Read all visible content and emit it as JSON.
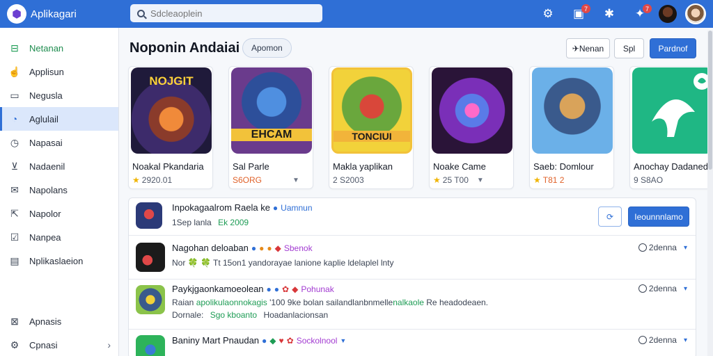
{
  "app": {
    "name": "Aplikagari"
  },
  "search": {
    "placeholder": "Sdcleaoplein"
  },
  "top_icons": [
    {
      "icon": "gear-icon"
    },
    {
      "icon": "bookmark-icon",
      "badge": "7"
    },
    {
      "icon": "bell-icon",
      "badge": ""
    },
    {
      "icon": "share-icon",
      "badge": "7"
    }
  ],
  "sidebar": {
    "items": [
      {
        "label": "Netanan",
        "icon": "store-icon"
      },
      {
        "label": "Applisun",
        "icon": "pointer-icon"
      },
      {
        "label": "Negusla",
        "icon": "window-icon"
      },
      {
        "label": "Aglulail",
        "icon": "gauge-icon",
        "active": true
      },
      {
        "label": "Napasai",
        "icon": "clock-icon"
      },
      {
        "label": "Nadaenil",
        "icon": "download-icon"
      },
      {
        "label": "Napolans",
        "icon": "mail-icon"
      },
      {
        "label": "Napolor",
        "icon": "export-icon"
      },
      {
        "label": "Nanpea",
        "icon": "check-box-icon"
      },
      {
        "label": "Nplikaslaeion",
        "icon": "list-icon"
      }
    ],
    "bottom": [
      {
        "label": "Apnasis",
        "icon": "chart-icon"
      },
      {
        "label": "Cpnasi",
        "icon": "settings-icon"
      }
    ]
  },
  "main": {
    "title": "Noponin Andaiai",
    "pill": "Apomon",
    "buttons": {
      "filter": "✈Nenan",
      "sort": "Spl",
      "primary": "Pardnof"
    }
  },
  "cards": [
    {
      "title": "Noakal Pkandaria",
      "meta": "2920.01",
      "rating": true,
      "art_text": "NOJGIT"
    },
    {
      "title": "Sal Parle",
      "meta": "S6ORG",
      "price": true,
      "dropdown": true,
      "art_text": "EHCAM"
    },
    {
      "title": "Makla yaplikan",
      "meta": "2 S2003",
      "art_text": "TONCIUI"
    },
    {
      "title": "Noake Came",
      "meta": "25 T00",
      "rating": true,
      "dropdown": true,
      "art_text": ""
    },
    {
      "title": "Saeb: Domlour",
      "meta": "T81 2",
      "rating": true,
      "price": true,
      "art_text": ""
    },
    {
      "title": "Anochay Dadaned",
      "meta": "9 S8AO",
      "art_text": ""
    }
  ],
  "feed": {
    "header": {
      "title": "Inpokagaalrom Raela ke",
      "tag": "Uamnun",
      "sub_prefix": "1Sep lanla",
      "sub_value": "Ek 2009",
      "refresh_label": "⟳",
      "action": "Ieounnnlamo"
    },
    "rows": [
      {
        "title": "Nagohan deloaban",
        "tag": "Sbenok",
        "line1": "Nor 🍀 🍀 Tt 15on1 yandorayae lanione kaplie ldelaplel lnty",
        "line2": "",
        "time": "2denna"
      },
      {
        "title": "Paykjgaonkamoeolean",
        "tag": "Pohunak",
        "line1_prefix": "Raian",
        "line1_green": "apolikulaonnokagis",
        "line1_mid": "'100 9ke bolan sailandlanbnmelle",
        "line1_green2": "nalkaole",
        "line1_end": "Re headodeaen.",
        "line2_label": "Dornale:",
        "line2_green": "Sgo kboanto",
        "line2_end": "Hoadanlacionsan",
        "time": "2denna"
      },
      {
        "title": "Baniny Mart Pnaudan",
        "tag": "Sockolnool",
        "line1": "",
        "line2": "",
        "time": "2denna"
      }
    ]
  }
}
